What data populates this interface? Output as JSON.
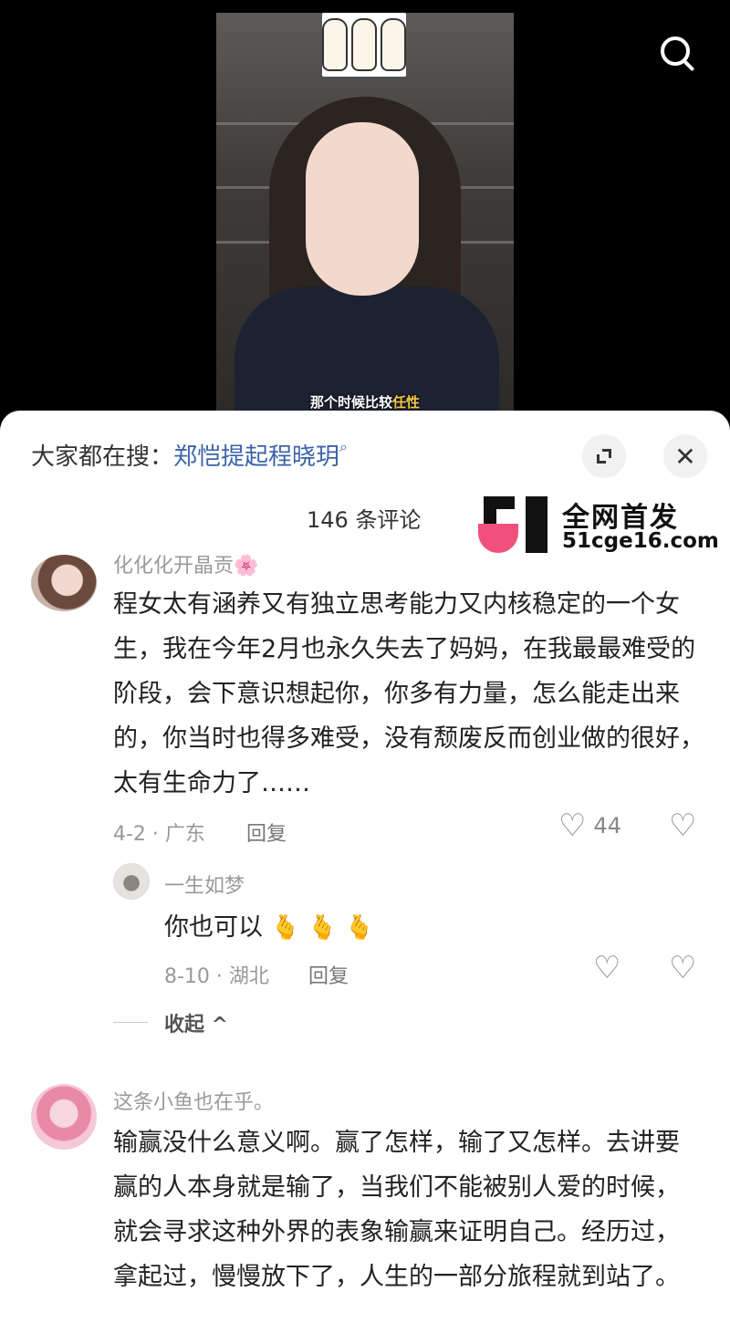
{
  "video": {
    "subtitle_pre": "那个时候比较",
    "subtitle_hl": "任性"
  },
  "sheet": {
    "search_prefix": "大家都在搜：",
    "search_keyword": "郑恺提起程晓玥",
    "comment_count": "146 条评论",
    "collapse_label": "收起 ^"
  },
  "watermark": {
    "title": "全网首发",
    "url": "51cge16.com"
  },
  "comments": [
    {
      "user": "化化化开晶贡🌸",
      "text": "程女太有涵养又有独立思考能力又内核稳定的一个女生，我在今年2月也永久失去了妈妈，在我最最难受的阶段，会下意识想起你，你多有力量，怎么能走出来的，你当时也得多难受，没有颓废反而创业做的很好，太有生命力了……",
      "meta": "4-2 · 广东",
      "reply": "回复",
      "likes": "44"
    },
    {
      "user": "一生如梦",
      "text": "你也可以",
      "emojis": "🫰 🫰 🫰",
      "meta": "8-10 · 湖北",
      "reply": "回复",
      "likes": ""
    },
    {
      "user": "这条小鱼也在乎。",
      "text": "输赢没什么意义啊。赢了怎样，输了又怎样。去讲要赢的人本身就是输了，当我们不能被别人爱的时候，就会寻求这种外界的表象输赢来证明自己。经历过，拿起过，慢慢放下了，人生的一部分旅程就到站了。"
    }
  ],
  "icons": {
    "search": "search-icon",
    "expand": "expand-icon",
    "close": "close-icon",
    "heart": "heart-icon",
    "dislike": "broken-heart-icon"
  },
  "colors": {
    "keyword": "#3a63a9",
    "watermark_pink": "#f0507a",
    "sheet_bg": "#ffffff"
  }
}
